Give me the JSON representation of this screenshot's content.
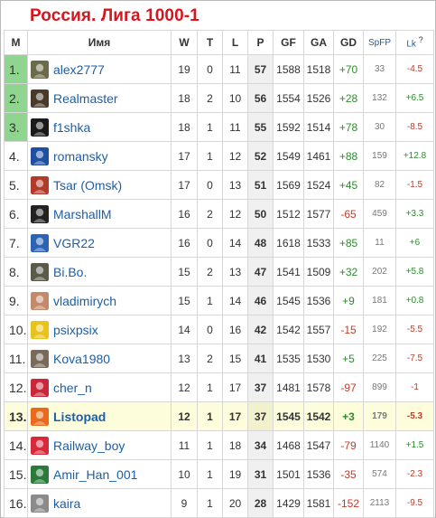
{
  "title": "Россия. Лига 1000-1",
  "columns": {
    "rank": "М",
    "name": "Имя",
    "w": "W",
    "t": "T",
    "l": "L",
    "p": "P",
    "gf": "GF",
    "ga": "GA",
    "gd": "GD",
    "spfp": "SpFP",
    "lk": "Lk",
    "lk_help": "?"
  },
  "rows": [
    {
      "rank": "1.",
      "name": "alex2777",
      "w": "19",
      "t": "0",
      "l": "11",
      "p": "57",
      "gf": "1588",
      "ga": "1518",
      "gd": "+70",
      "spfp": "33",
      "lk": "-4.5",
      "avatar": "bird-avatar-icon",
      "avatar_color": "#6b6a4a"
    },
    {
      "rank": "2.",
      "name": "Realmaster",
      "w": "18",
      "t": "2",
      "l": "10",
      "p": "56",
      "gf": "1554",
      "ga": "1526",
      "gd": "+28",
      "spfp": "132",
      "lk": "+6.5",
      "avatar": "badge-avatar-icon",
      "avatar_color": "#4a3a2a"
    },
    {
      "rank": "3.",
      "name": "f1shka",
      "w": "18",
      "t": "1",
      "l": "11",
      "p": "55",
      "gf": "1592",
      "ga": "1514",
      "gd": "+78",
      "spfp": "30",
      "lk": "-8.5",
      "avatar": "dark-face-avatar-icon",
      "avatar_color": "#1a1a1a"
    },
    {
      "rank": "4.",
      "name": "romansky",
      "w": "17",
      "t": "1",
      "l": "12",
      "p": "52",
      "gf": "1549",
      "ga": "1461",
      "gd": "+88",
      "spfp": "159",
      "lk": "+12.8",
      "avatar": "chelsea-crest-icon",
      "avatar_color": "#1e4fa0"
    },
    {
      "rank": "5.",
      "name": "Tsar (Omsk)",
      "w": "17",
      "t": "0",
      "l": "13",
      "p": "51",
      "gf": "1569",
      "ga": "1524",
      "gd": "+45",
      "spfp": "82",
      "lk": "-1.5",
      "avatar": "eagle-avatar-icon",
      "avatar_color": "#b23a2a"
    },
    {
      "rank": "6.",
      "name": "MarshallM",
      "w": "16",
      "t": "2",
      "l": "12",
      "p": "50",
      "gf": "1512",
      "ga": "1577",
      "gd": "-65",
      "spfp": "459",
      "lk": "+3.3",
      "avatar": "cartoon-avatar-icon",
      "avatar_color": "#222222"
    },
    {
      "rank": "7.",
      "name": "VGR22",
      "w": "16",
      "t": "0",
      "l": "14",
      "p": "48",
      "gf": "1618",
      "ga": "1533",
      "gd": "+85",
      "spfp": "11",
      "lk": "+6",
      "avatar": "dynamo-logo-icon",
      "avatar_color": "#2c63b5"
    },
    {
      "rank": "8.",
      "name": "Bi.Bo.",
      "w": "15",
      "t": "2",
      "l": "13",
      "p": "47",
      "gf": "1541",
      "ga": "1509",
      "gd": "+32",
      "spfp": "202",
      "lk": "+5.8",
      "avatar": "photo-avatar-icon",
      "avatar_color": "#5a5a4a"
    },
    {
      "rank": "9.",
      "name": "vladimirych",
      "w": "15",
      "t": "1",
      "l": "14",
      "p": "46",
      "gf": "1545",
      "ga": "1536",
      "gd": "+9",
      "spfp": "181",
      "lk": "+0.8",
      "avatar": "face-avatar-icon",
      "avatar_color": "#c28a6a"
    },
    {
      "rank": "10.",
      "name": "psixpsix",
      "w": "14",
      "t": "0",
      "l": "16",
      "p": "42",
      "gf": "1542",
      "ga": "1557",
      "gd": "-15",
      "spfp": "192",
      "lk": "-5.5",
      "avatar": "trophy-avatar-icon",
      "avatar_color": "#e8c31c"
    },
    {
      "rank": "11.",
      "name": "Kova1980",
      "w": "13",
      "t": "2",
      "l": "15",
      "p": "41",
      "gf": "1535",
      "ga": "1530",
      "gd": "+5",
      "spfp": "225",
      "lk": "-7.5",
      "avatar": "person-avatar-icon",
      "avatar_color": "#7a6a5a"
    },
    {
      "rank": "12.",
      "name": "cher_n",
      "w": "12",
      "t": "1",
      "l": "17",
      "p": "37",
      "gf": "1481",
      "ga": "1578",
      "gd": "-97",
      "spfp": "899",
      "lk": "-1",
      "avatar": "spartak-avatar-icon",
      "avatar_color": "#c8283a"
    },
    {
      "rank": "13.",
      "name": "Listopad",
      "w": "12",
      "t": "1",
      "l": "17",
      "p": "37",
      "gf": "1545",
      "ga": "1542",
      "gd": "+3",
      "spfp": "179",
      "lk": "-5.3",
      "avatar": "leaf-avatar-icon",
      "avatar_color": "#e86a1a",
      "me": true
    },
    {
      "rank": "14.",
      "name": "Railway_boy",
      "w": "11",
      "t": "1",
      "l": "18",
      "p": "34",
      "gf": "1468",
      "ga": "1547",
      "gd": "-79",
      "spfp": "1140",
      "lk": "+1.5",
      "avatar": "lokomotiv-heart-icon",
      "avatar_color": "#d8283a"
    },
    {
      "rank": "15.",
      "name": "Amir_Han_001",
      "w": "10",
      "t": "1",
      "l": "19",
      "p": "31",
      "gf": "1501",
      "ga": "1536",
      "gd": "-35",
      "spfp": "574",
      "lk": "-2.3",
      "avatar": "green-avatar-icon",
      "avatar_color": "#2a7a3a"
    },
    {
      "rank": "16.",
      "name": "kaira",
      "w": "9",
      "t": "1",
      "l": "20",
      "p": "28",
      "gf": "1429",
      "ga": "1581",
      "gd": "-152",
      "spfp": "2113",
      "lk": "-9.5",
      "avatar": "cat-avatar-icon",
      "avatar_color": "#8a8a8a"
    }
  ]
}
